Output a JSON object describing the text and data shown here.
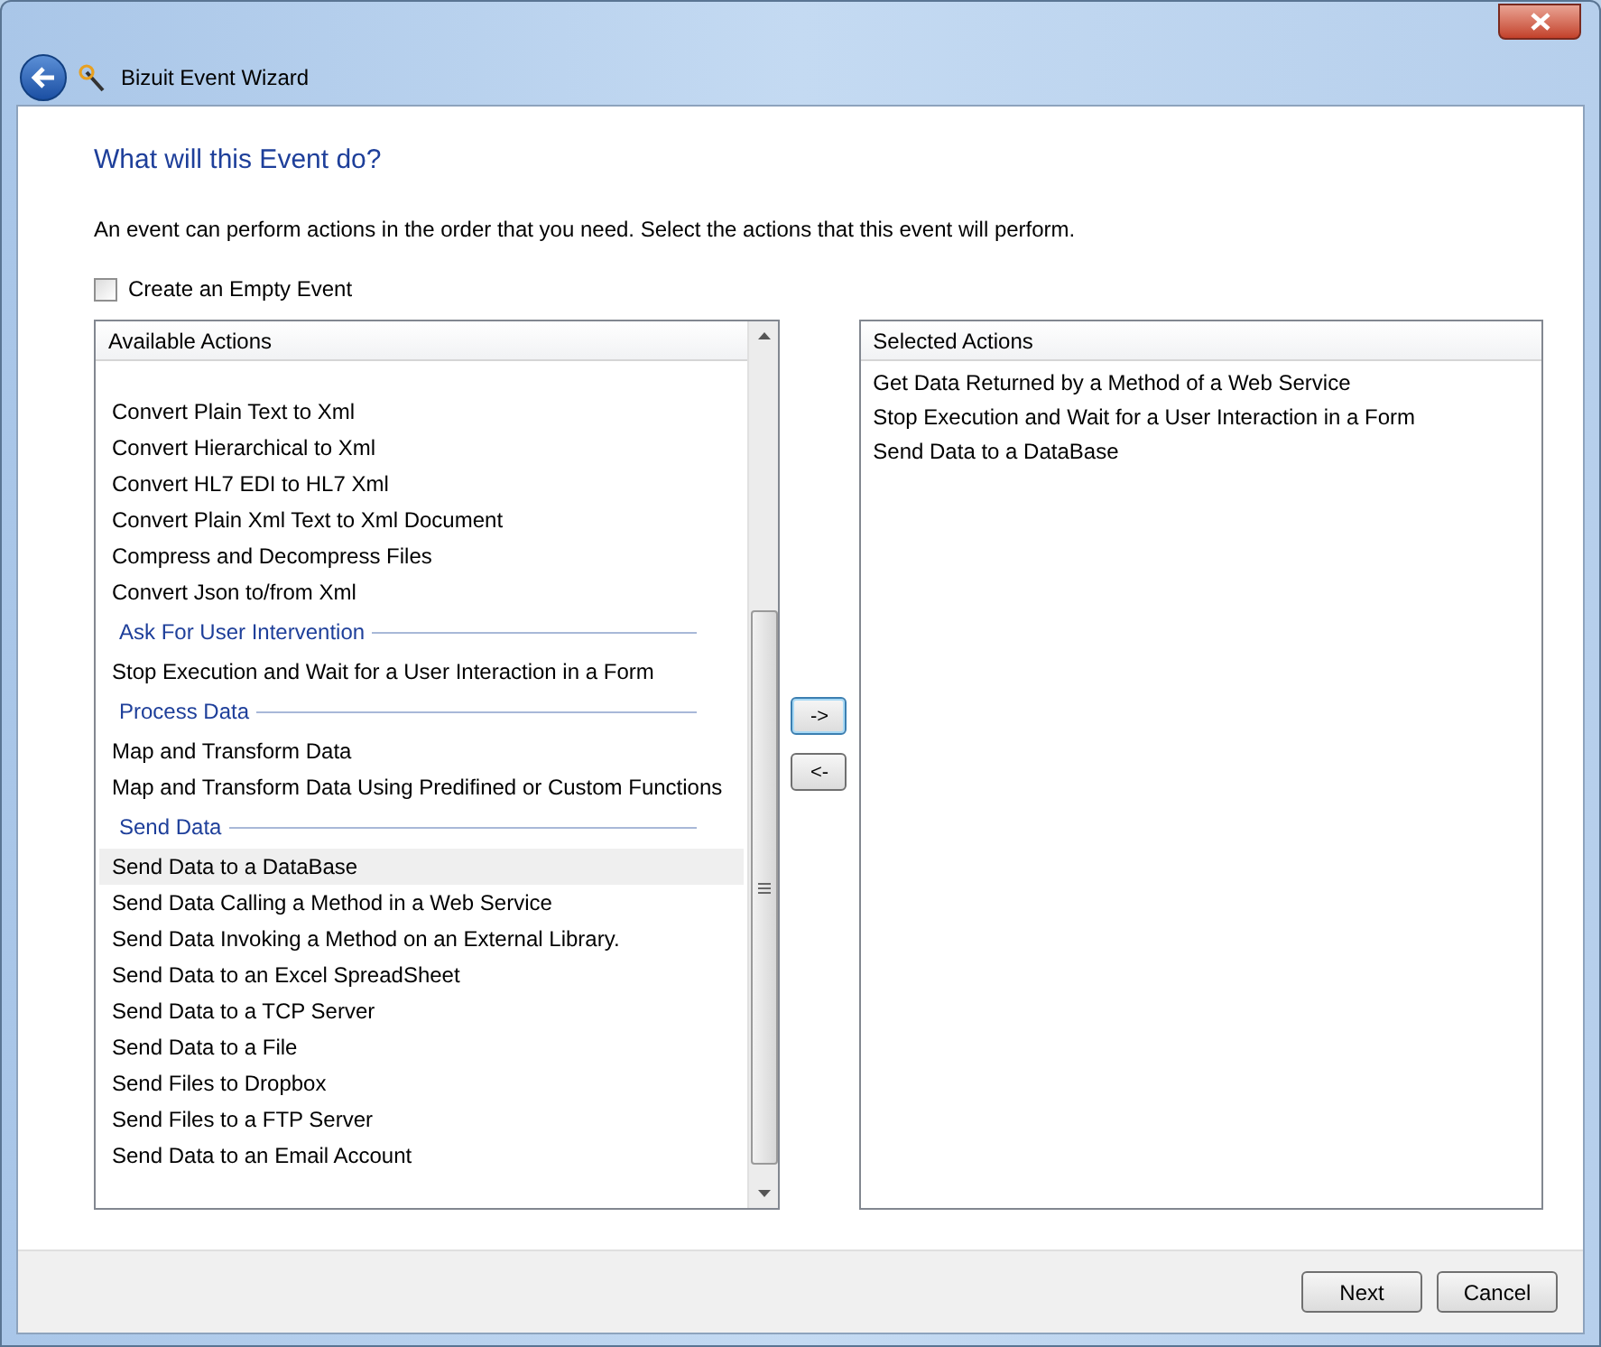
{
  "window": {
    "title": "Bizuit Event Wizard"
  },
  "heading": "What will this Event do?",
  "description": "An event can perform actions in the order that you need. Select the actions that this event will perform.",
  "empty_event": {
    "label": "Create an Empty Event",
    "checked": false
  },
  "available": {
    "header": "Available Actions",
    "items": [
      {
        "kind": "item",
        "label": "Convert Plain Text to Xml",
        "selected": false
      },
      {
        "kind": "item",
        "label": "Convert Hierarchical to Xml",
        "selected": false
      },
      {
        "kind": "item",
        "label": "Convert HL7 EDI to HL7 Xml",
        "selected": false
      },
      {
        "kind": "item",
        "label": "Convert Plain Xml Text to Xml Document",
        "selected": false
      },
      {
        "kind": "item",
        "label": "Compress and Decompress Files",
        "selected": false
      },
      {
        "kind": "item",
        "label": "Convert Json to/from Xml",
        "selected": false
      },
      {
        "kind": "group",
        "label": "Ask For User Intervention"
      },
      {
        "kind": "item",
        "label": "Stop Execution and Wait for a User Interaction in a Form",
        "selected": false
      },
      {
        "kind": "group",
        "label": "Process Data"
      },
      {
        "kind": "item",
        "label": "Map and Transform Data",
        "selected": false
      },
      {
        "kind": "item",
        "label": "Map and Transform Data Using Predifined or Custom Functions",
        "selected": false
      },
      {
        "kind": "group",
        "label": "Send Data"
      },
      {
        "kind": "item",
        "label": "Send Data to a DataBase",
        "selected": true
      },
      {
        "kind": "item",
        "label": "Send Data Calling a Method in a Web Service",
        "selected": false
      },
      {
        "kind": "item",
        "label": "Send Data Invoking a Method on an External Library.",
        "selected": false
      },
      {
        "kind": "item",
        "label": "Send Data to an Excel SpreadSheet",
        "selected": false
      },
      {
        "kind": "item",
        "label": "Send Data to a TCP Server",
        "selected": false
      },
      {
        "kind": "item",
        "label": "Send Data to a File",
        "selected": false
      },
      {
        "kind": "item",
        "label": "Send Files to Dropbox",
        "selected": false
      },
      {
        "kind": "item",
        "label": "Send Files to a FTP Server",
        "selected": false
      },
      {
        "kind": "item",
        "label": "Send Data to an Email Account",
        "selected": false
      }
    ]
  },
  "move_buttons": [
    "->",
    "<-"
  ],
  "selected": {
    "header": "Selected Actions",
    "items": [
      "Get Data Returned by a Method of a Web Service",
      "Stop Execution and Wait for a User Interaction in a Form",
      "Send Data to a DataBase"
    ]
  },
  "buttons": [
    "Next",
    "Cancel"
  ]
}
